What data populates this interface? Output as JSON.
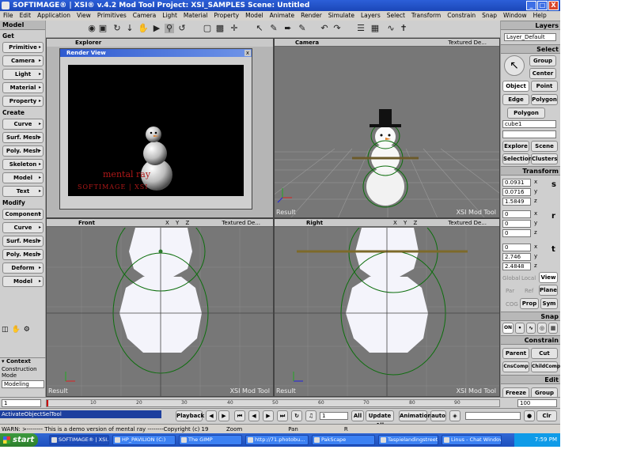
{
  "window": {
    "title": "SOFTIMAGE® | XSI® v.4.2 Mod Tool Project: XSI_SAMPLES   Scene: Untitled",
    "buttons": [
      "_",
      "□",
      "X"
    ]
  },
  "menu": [
    "File",
    "Edit",
    "Application",
    "View",
    "Primitives",
    "Camera",
    "Light",
    "Material",
    "Property",
    "Model",
    "Animate",
    "Render",
    "Simulate",
    "Layers",
    "Select",
    "Transform",
    "Constrain",
    "Snap",
    "Window",
    "Help"
  ],
  "left_panel": {
    "module": "Model",
    "get_label": "Get",
    "get_items": [
      "Primitive",
      "Camera",
      "Light",
      "Material",
      "Property"
    ],
    "create_label": "Create",
    "create_items": [
      "Curve",
      "Surf. Mesh",
      "Poly. Mesh",
      "Skeleton",
      "Model",
      "Text"
    ],
    "modify_label": "Modify",
    "modify_items": [
      "Component",
      "Curve",
      "Surf. Mesh",
      "Poly. Mesh",
      "Deform",
      "Model"
    ],
    "context_label": "Context",
    "construction_mode_label": "Construction Mode",
    "construction_mode_value": "Modeling"
  },
  "viewports": {
    "explorer": {
      "name": "Explorer"
    },
    "render_view": {
      "title": "Render View",
      "logo_text": "mental ray",
      "sub_text": "SOFTIMAGE | XSI"
    },
    "camera": {
      "name": "Camera",
      "mode": "Textured De...",
      "label": "Result",
      "watermark": "XSI Mod Tool"
    },
    "front": {
      "name": "Front",
      "mode": "Textured De...",
      "label": "Result",
      "watermark": "XSI Mod Tool"
    },
    "right": {
      "name": "Right",
      "mode": "Textured De...",
      "label": "Result",
      "watermark": "XSI Mod Tool"
    },
    "axis_letters": "X Y Z"
  },
  "right_panel": {
    "layers_label": "Layers",
    "layer_value": "Layer_Default",
    "select_label": "Select",
    "group_label": "Group",
    "center_label": "Center",
    "object_label": "Object",
    "point_label": "Point",
    "edge_label": "Edge",
    "polygon_label": "Polygon",
    "polygon_label2": "Polygon",
    "selection_name": "cube1",
    "explore_label": "Explore",
    "scene_label": "Scene",
    "selection_label": "Selection",
    "clusters_label": "Clusters",
    "transform_label": "Transform",
    "scale": [
      "0.0931",
      "0.0716",
      "1.5849"
    ],
    "rotate": [
      "0",
      "0",
      "0"
    ],
    "translate": [
      "0",
      "2.746",
      "2.4848"
    ],
    "axis_x": "x",
    "axis_y": "y",
    "axis_z": "z",
    "s_label": "s",
    "r_label": "r",
    "t_label": "t",
    "ref_global": "Global",
    "ref_local": "Local",
    "ref_view": "View",
    "ref_par": "Par",
    "ref_ref": "Ref",
    "ref_plane": "Plane",
    "cog_label": "COG",
    "prop_label": "Prop",
    "sym_label": "Sym",
    "snap_label": "Snap",
    "snap_on": "ON",
    "constrain_label": "Constrain",
    "parent_label": "Parent",
    "cut_label": "Cut",
    "cnscomp_label": "CnsComp",
    "childcomp_label": "ChildComp",
    "edit_label": "Edit",
    "freeze_label": "Freeze",
    "group_edit_label": "Group"
  },
  "timeline": {
    "start": "1",
    "end": "100",
    "ticks": [
      "10",
      "20",
      "30",
      "40",
      "50",
      "60",
      "70",
      "80",
      "90"
    ]
  },
  "playback": {
    "command": "ActivateObjectSelTool",
    "playback_label": "Playback",
    "frame_value": "1",
    "all_label": "All",
    "update_all_label": "Update All",
    "animation_label": "Animation",
    "auto_label": "auto"
  },
  "status": {
    "message": "WARN: >-------- This is a demo version of mental ray --------Copyright (c) 19",
    "mouse_left": "Zoom",
    "mouse_middle": "Pan",
    "mouse_right": "R"
  },
  "taskbar": {
    "start": "start",
    "tasks": [
      "SOFTIMAGE® | XSI...",
      "HP_PAVILION (C:)",
      "The GIMP",
      "http://71.photobu...",
      "PakScape",
      "Taspielandingstreet...",
      "Linus - Chat Window"
    ],
    "time": "7:59 PM"
  }
}
